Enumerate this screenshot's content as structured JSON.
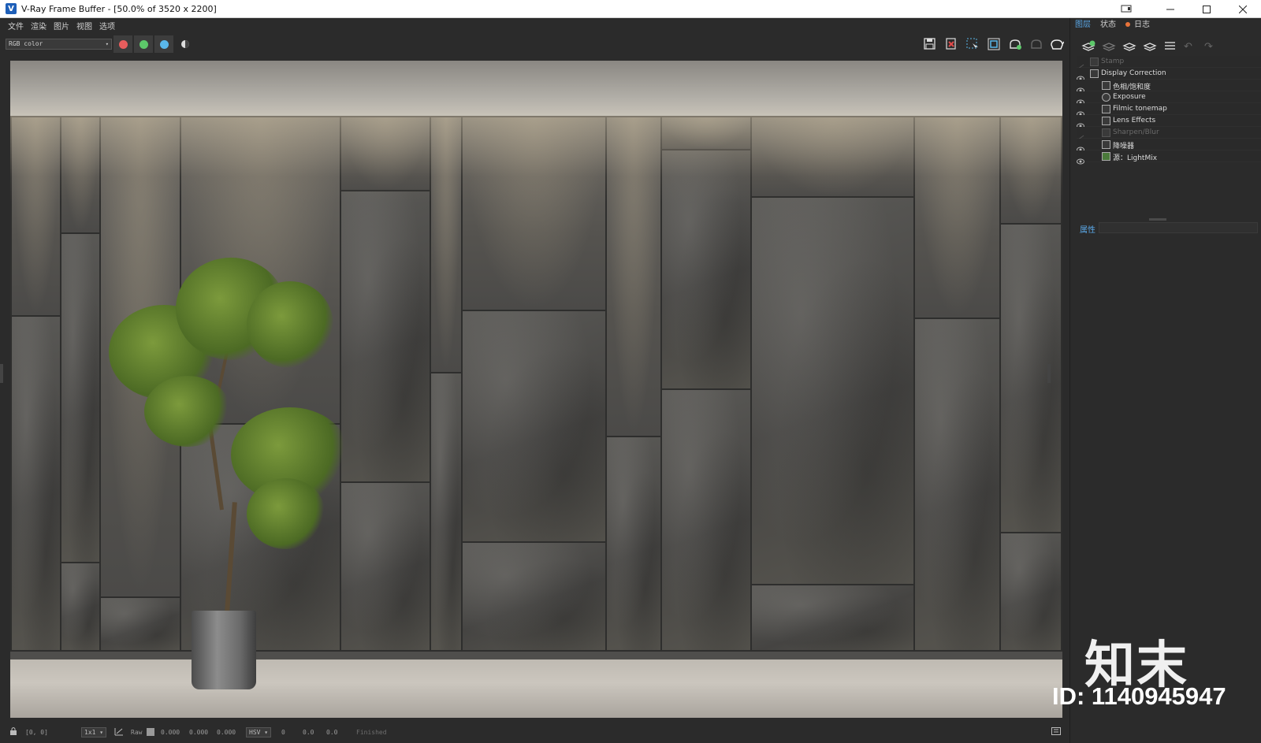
{
  "window": {
    "title": "V-Ray Frame Buffer - [50.0% of 3520 x 2200]",
    "app_icon_glyph": "V"
  },
  "menu": {
    "items": [
      "文件",
      "渲染",
      "图片",
      "视图",
      "选项"
    ]
  },
  "toolbar": {
    "channel_value": "RGB color",
    "channel_buttons": [
      {
        "name": "red",
        "color": "#e85d5d"
      },
      {
        "name": "green",
        "color": "#5dc86a"
      },
      {
        "name": "blue",
        "color": "#5ab7ea"
      }
    ],
    "icons": [
      "save-icon",
      "clear-icon",
      "region-select-icon",
      "region-render-icon",
      "interactive-render-icon",
      "stop-render-icon",
      "render-teapot-icon"
    ]
  },
  "right_panel": {
    "tabs": [
      "图层",
      "状态",
      "日志"
    ],
    "toolbar_icons": [
      "add-layer-icon",
      "remove-layer-icon",
      "save-layer-icon",
      "load-layer-icon",
      "list-menu-icon",
      "undo-icon",
      "redo-icon"
    ],
    "layers": [
      {
        "label": "Stamp",
        "enabled": false,
        "indent": 0
      },
      {
        "label": "Display Correction",
        "enabled": true,
        "indent": 0
      },
      {
        "label": "色相/饱和度",
        "enabled": true,
        "indent": 1
      },
      {
        "label": "Exposure",
        "enabled": true,
        "indent": 1
      },
      {
        "label": "Filmic tonemap",
        "enabled": true,
        "indent": 1
      },
      {
        "label": "Lens Effects",
        "enabled": true,
        "indent": 1
      },
      {
        "label": "Sharpen/Blur",
        "enabled": false,
        "indent": 1
      },
      {
        "label": "降噪器",
        "enabled": true,
        "indent": 1
      },
      {
        "label": "源：LightMix",
        "enabled": true,
        "indent": 1
      }
    ],
    "properties_label": "属性"
  },
  "status": {
    "coords": "[0, 0]",
    "zoom": "1x1",
    "raw_label": "Raw",
    "rgb_values": [
      "0.000",
      "0.000",
      "0.000"
    ],
    "color_mode": "HSV",
    "hsv_values": [
      "0",
      "0.0",
      "0.0"
    ],
    "state": "Finished"
  },
  "watermark": {
    "brand": "知末",
    "id": "ID: 1140945947"
  }
}
